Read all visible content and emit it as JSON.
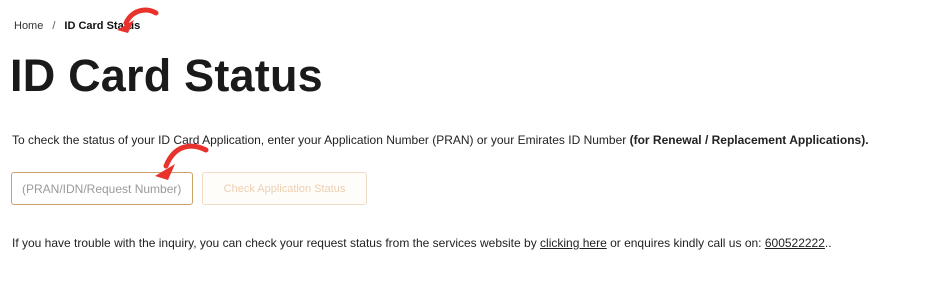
{
  "breadcrumb": {
    "home": "Home",
    "separator": "/",
    "current": "ID Card Status"
  },
  "page_title": "ID Card Status",
  "intro": {
    "text": "To check the status of your ID Card Application, enter your Application Number (PRAN) or your Emirates ID Number ",
    "bold": "(for Renewal / Replacement Applications)."
  },
  "form": {
    "input_placeholder": "(PRAN/IDN/Request Number)",
    "input_value": "",
    "button_label": "Check Application Status"
  },
  "help": {
    "prefix": "If you have trouble with the inquiry, you can check your request status from the services website by ",
    "link_text": "clicking here",
    "middle": " or enquires kindly call us on: ",
    "phone": "600522222",
    "suffix": ".."
  },
  "colors": {
    "arrow": "#e8322b",
    "input_border": "#c8a267",
    "button_text": "#eccfb0"
  },
  "icons": [
    "curved-arrow-icon"
  ]
}
